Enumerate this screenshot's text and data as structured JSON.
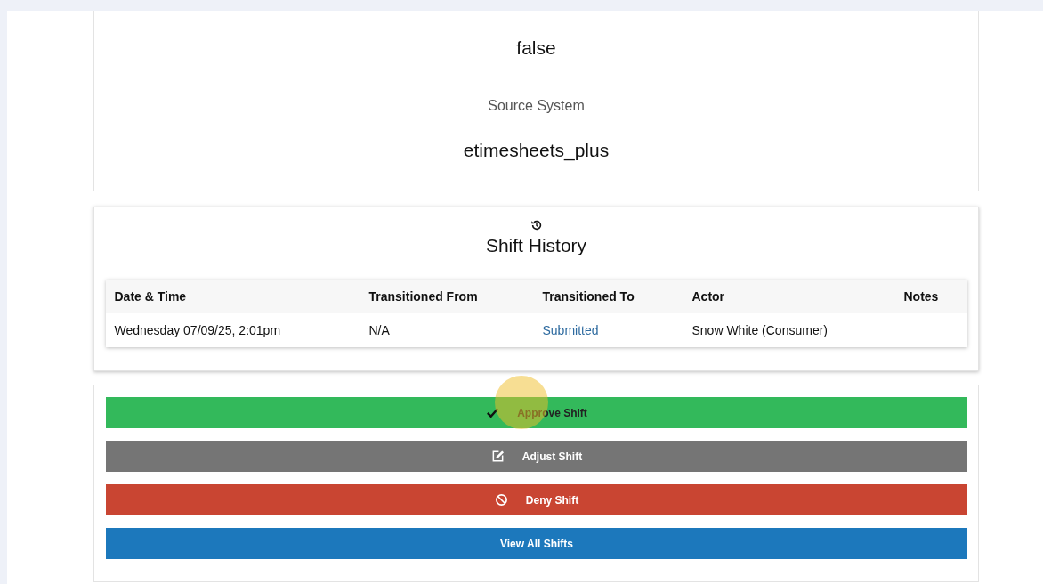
{
  "details": [
    {
      "value": "false"
    },
    {
      "label": "Source System",
      "value": "etimesheets_plus"
    }
  ],
  "history": {
    "title": "Shift History",
    "columns": [
      "Date & Time",
      "Transitioned From",
      "Transitioned To",
      "Actor",
      "Notes"
    ],
    "rows": [
      {
        "date_time": "Wednesday 07/09/25, 2:01pm",
        "from": "N/A",
        "to": "Submitted",
        "actor": "Snow White (Consumer)"
      }
    ]
  },
  "actions": [
    {
      "label": "Approve Shift",
      "kind": "approve"
    },
    {
      "label": "Adjust Shift",
      "kind": "adjust"
    },
    {
      "label": "Deny Shift",
      "kind": "deny"
    },
    {
      "label": "View All Shifts",
      "kind": "view"
    }
  ]
}
